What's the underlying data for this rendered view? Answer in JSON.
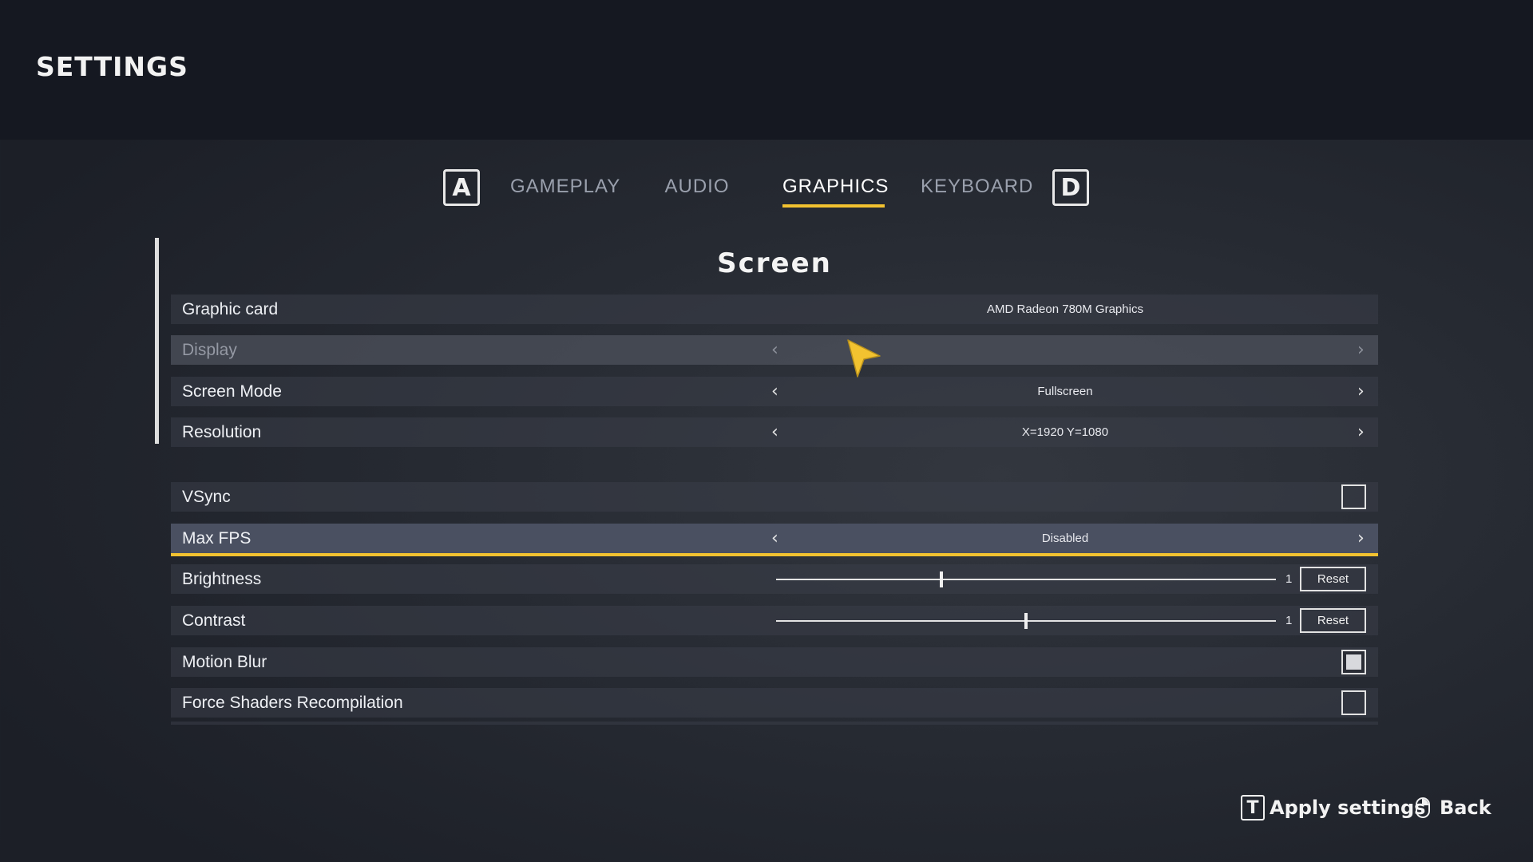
{
  "page": {
    "title": "SETTINGS"
  },
  "tabs": {
    "prev_key": "A",
    "next_key": "D",
    "items": [
      {
        "label": "GAMEPLAY"
      },
      {
        "label": "AUDIO"
      },
      {
        "label": "GRAPHICS",
        "active": true
      },
      {
        "label": "KEYBOARD"
      }
    ]
  },
  "section": {
    "title": "Screen"
  },
  "rows": {
    "graphic_card": {
      "label": "Graphic card",
      "value": "AMD Radeon 780M Graphics"
    },
    "display": {
      "label": "Display",
      "value": "",
      "disabled": true
    },
    "screen_mode": {
      "label": "Screen Mode",
      "value": "Fullscreen"
    },
    "resolution": {
      "label": "Resolution",
      "value": "X=1920 Y=1080"
    },
    "vsync": {
      "label": "VSync",
      "checked": false
    },
    "max_fps": {
      "label": "Max FPS",
      "value": "Disabled",
      "focused": true
    },
    "brightness": {
      "label": "Brightness",
      "value": "1",
      "slider_fraction": 0.33,
      "reset_label": "Reset"
    },
    "contrast": {
      "label": "Contrast",
      "value": "1",
      "slider_fraction": 0.5,
      "reset_label": "Reset"
    },
    "motion_blur": {
      "label": "Motion Blur",
      "checked": true
    },
    "force_shaders": {
      "label": "Force Shaders Recompilation",
      "checked": false
    }
  },
  "footer": {
    "apply_key": "T",
    "apply_label": "Apply settings",
    "back_label": "Back"
  },
  "colors": {
    "accent": "#f2c230",
    "cursor": "#f2c230",
    "background": "#262a32"
  },
  "icons": {
    "arrow_left": "chevron-left-icon",
    "arrow_right": "chevron-right-icon",
    "pointer": "cursor-pointer-icon",
    "mouse": "mouse-icon"
  }
}
